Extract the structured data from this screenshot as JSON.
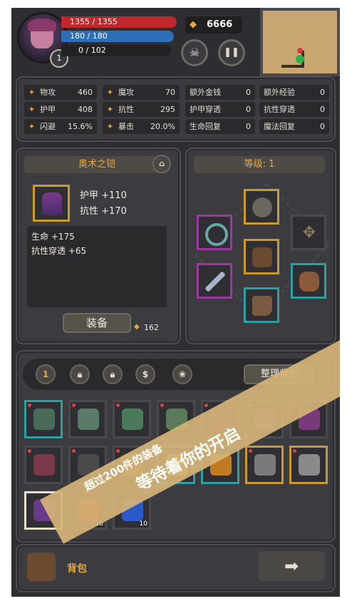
{
  "colors": {
    "hp": "#c0282c",
    "mp": "#2f6db6",
    "xp": "#222225",
    "gold_border": "#c99a2e",
    "teal_border": "#2f9ea0",
    "purple_border": "#9b3a9e",
    "accent_text": "#e6a94a"
  },
  "header": {
    "hp": "1355 / 1355",
    "mp": "180 / 180",
    "xp": "0 / 102",
    "level": "1",
    "gold": "6666",
    "gold_icon": "coin-icon",
    "skull_icon": "skull-icon",
    "pause_icon": "pause-icon"
  },
  "stats": [
    {
      "icon": "sword-icon",
      "label": "物攻",
      "value": "460"
    },
    {
      "icon": "boot-icon",
      "label": "魔攻",
      "value": "70"
    },
    {
      "label": "额外金钱",
      "value": "0"
    },
    {
      "label": "额外经验",
      "value": "0"
    },
    {
      "icon": "paw-icon",
      "label": "护甲",
      "value": "408"
    },
    {
      "icon": "trophy-icon",
      "label": "抗性",
      "value": "295"
    },
    {
      "label": "护甲穿透",
      "value": "0"
    },
    {
      "label": "抗性穿透",
      "value": "0"
    },
    {
      "icon": "run-icon",
      "label": "闪避",
      "value": "15.6%"
    },
    {
      "icon": "bolt-icon",
      "label": "暴击",
      "value": "20.0%"
    },
    {
      "label": "生命回复",
      "value": "0"
    },
    {
      "label": "魔法回复",
      "value": "0"
    }
  ],
  "item": {
    "name": "奥术之铠",
    "stat1": "护甲 +110",
    "stat2": "抗性 +170",
    "extra1": "生命 +175",
    "extra2": "抗性穿透 +65",
    "equip_label": "装备",
    "price": "162",
    "lock_icon": "trash-icon"
  },
  "equipment": {
    "title": "等级: 1"
  },
  "bag": {
    "tab1": "1",
    "sort_label": "整理背包",
    "rows": [
      [
        "teal",
        "",
        "",
        "",
        "",
        "",
        ""
      ],
      [
        "",
        "",
        "",
        "teal",
        "teal",
        "gold",
        "gold"
      ],
      [
        "white",
        "",
        ""
      ]
    ],
    "potion_count": "10"
  },
  "bottom": {
    "bag_label": "背包",
    "arrow": "➡"
  },
  "banner": {
    "line1": "超过200件的装备",
    "line2": "等待着你的开启"
  }
}
